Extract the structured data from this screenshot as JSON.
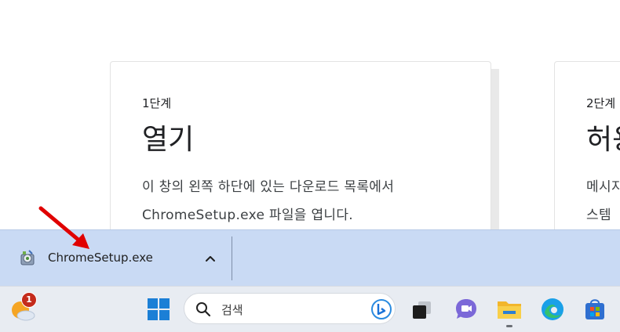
{
  "steps": [
    {
      "label": "1단계",
      "title": "열기",
      "description_lines": [
        "이 창의 왼쪽 하단에 있는 다운로드 목록에서",
        "ChromeSetup.exe 파일을 엽니다."
      ]
    },
    {
      "label": "2단계",
      "title": "허용",
      "description_lines": [
        "메시지",
        "스템"
      ]
    }
  ],
  "download_bar": {
    "file_name": "ChromeSetup.exe"
  },
  "taskbar": {
    "search_placeholder": "검색",
    "notification_count": "1",
    "icons": [
      "weather-icon",
      "windows-start-icon",
      "search-icon",
      "bing-icon",
      "task-view-icon",
      "teams-chat-icon",
      "file-explorer-icon",
      "edge-icon",
      "store-icon"
    ]
  },
  "colors": {
    "download_bar_bg": "#c9daf4",
    "taskbar_bg": "#e8ecf2",
    "annotation_arrow": "#e00000",
    "badge": "#c42b1c"
  }
}
